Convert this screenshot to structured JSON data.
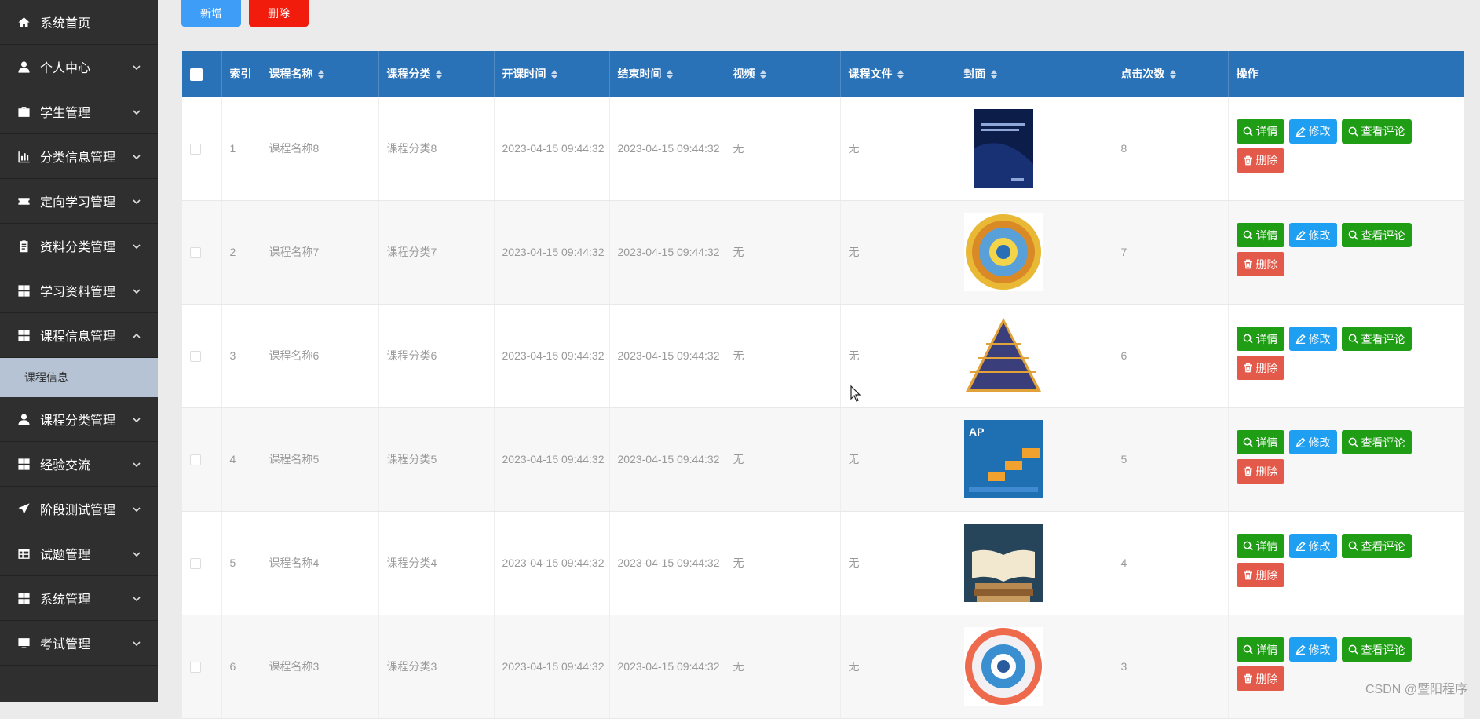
{
  "sidebar": {
    "items": [
      {
        "label": "系统首页",
        "icon": "home-icon",
        "expand": false
      },
      {
        "label": "个人中心",
        "icon": "user-icon",
        "expand": true
      },
      {
        "label": "学生管理",
        "icon": "briefcase-icon",
        "expand": true
      },
      {
        "label": "分类信息管理",
        "icon": "bar-chart-icon",
        "expand": true
      },
      {
        "label": "定向学习管理",
        "icon": "ticket-icon",
        "expand": true
      },
      {
        "label": "资料分类管理",
        "icon": "clipboard-icon",
        "expand": true
      },
      {
        "label": "学习资料管理",
        "icon": "grid-icon",
        "expand": true
      },
      {
        "label": "课程信息管理",
        "icon": "grid-icon",
        "expand": true,
        "open": true,
        "sub": [
          "课程信息"
        ]
      },
      {
        "label": "课程分类管理",
        "icon": "user-icon",
        "expand": true
      },
      {
        "label": "经验交流",
        "icon": "grid-icon",
        "expand": true
      },
      {
        "label": "阶段测试管理",
        "icon": "send-icon",
        "expand": true
      },
      {
        "label": "试题管理",
        "icon": "table-icon",
        "expand": true
      },
      {
        "label": "系统管理",
        "icon": "grid-icon",
        "expand": true
      },
      {
        "label": "考试管理",
        "icon": "monitor-icon",
        "expand": true
      }
    ]
  },
  "toolbar": {
    "add_label": "新增",
    "delete_label": "删除"
  },
  "table": {
    "headers": [
      "索引",
      "课程名称",
      "课程分类",
      "开课时间",
      "结束时间",
      "视频",
      "课程文件",
      "封面",
      "点击次数",
      "操作"
    ],
    "rows": [
      {
        "index": "1",
        "name": "课程名称8",
        "category": "课程分类8",
        "start": "2023-04-15 09:44:32",
        "end": "2023-04-15 09:44:32",
        "video": "无",
        "file": "无",
        "cover": "book-cover-dark",
        "clicks": "8"
      },
      {
        "index": "2",
        "name": "课程名称7",
        "category": "课程分类7",
        "start": "2023-04-15 09:44:32",
        "end": "2023-04-15 09:44:32",
        "video": "无",
        "file": "无",
        "cover": "circle-wheel",
        "clicks": "7"
      },
      {
        "index": "3",
        "name": "课程名称6",
        "category": "课程分类6",
        "start": "2023-04-15 09:44:32",
        "end": "2023-04-15 09:44:32",
        "video": "无",
        "file": "无",
        "cover": "pyramid",
        "clicks": "6"
      },
      {
        "index": "4",
        "name": "课程名称5",
        "category": "课程分类5",
        "start": "2023-04-15 09:44:32",
        "end": "2023-04-15 09:44:32",
        "video": "无",
        "file": "无",
        "cover": "ap-steps",
        "clicks": "5"
      },
      {
        "index": "5",
        "name": "课程名称4",
        "category": "课程分类4",
        "start": "2023-04-15 09:44:32",
        "end": "2023-04-15 09:44:32",
        "video": "无",
        "file": "无",
        "cover": "open-book",
        "clicks": "4"
      },
      {
        "index": "6",
        "name": "课程名称3",
        "category": "课程分类3",
        "start": "2023-04-15 09:44:32",
        "end": "2023-04-15 09:44:32",
        "video": "无",
        "file": "无",
        "cover": "orange-wheel",
        "clicks": "3"
      }
    ],
    "actions": {
      "detail": "详情",
      "edit": "修改",
      "review": "查看评论",
      "delete": "删除"
    }
  },
  "watermark": "CSDN @暨阳程序",
  "colors": {
    "sidebar_bg": "#2f2f2f",
    "sidebar_active_sub": "#b6c3d4",
    "table_header": "#2a72b8",
    "add_button": "#3d9df7",
    "delete_button": "#f11c0c",
    "detail_button": "#1f9d15",
    "edit_button": "#1e9ff2",
    "delete_row_button": "#e45a4a"
  }
}
